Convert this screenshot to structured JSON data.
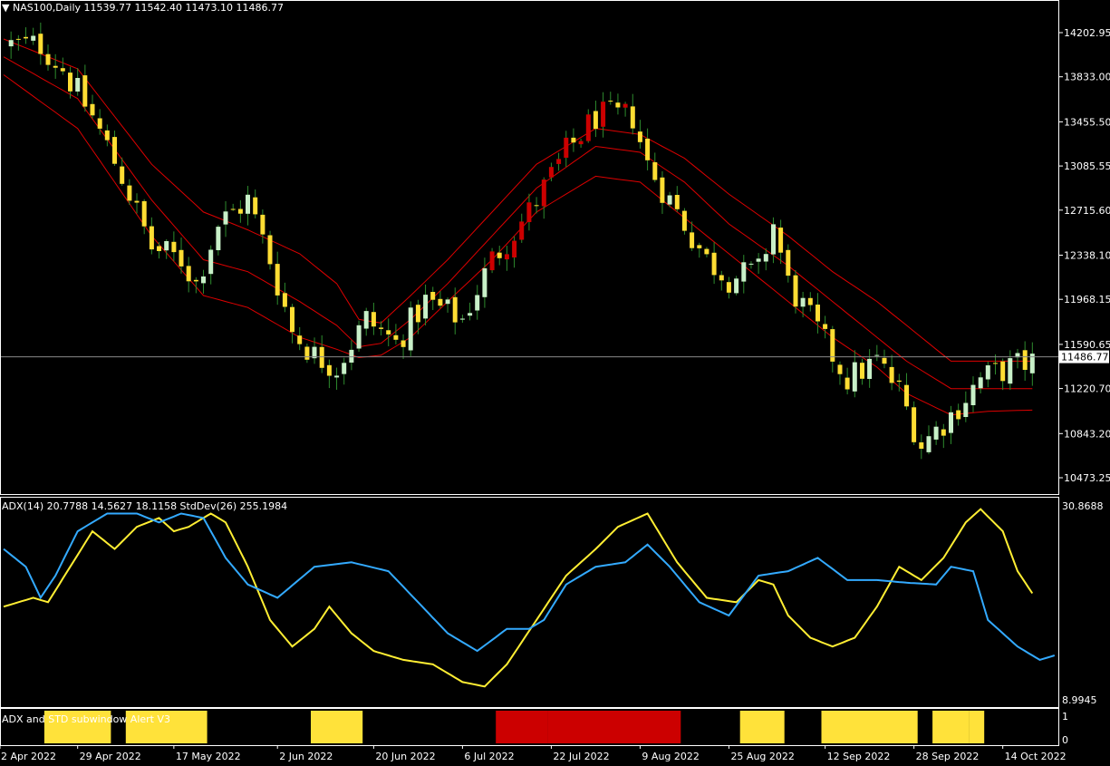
{
  "window": {
    "symbol_label": "NAS100,Daily",
    "ohlc": "11539.77 11542.40 11473.10 11486.77",
    "adx_label": "ADX(14) 20.7788 14.5627 18.1158  StdDev(26) 255.1984",
    "sub_label": "ADX and STD subwindow Alert V3"
  },
  "colors": {
    "background": "#000000",
    "grid_border": "#ffffff",
    "bull_candle": "#c8f0c8",
    "bear_candle": "#ffdd33",
    "red_candle": "#cc0000",
    "wick": "#2e8b2e",
    "envelope": "#dd0000",
    "adx_line": "#ffee33",
    "std_line": "#33aaff",
    "hist_yellow": "#ffe23a",
    "hist_red": "#cc0000",
    "price_line": "#8a8a8a"
  },
  "chart_data": [
    {
      "type": "candlestick",
      "panel": "price",
      "y_ticks": [
        "14202.95",
        "13833.00",
        "13455.50",
        "13085.55",
        "12715.60",
        "12338.10",
        "11968.15",
        "11590.65",
        "11220.70",
        "10843.20",
        "10473.25"
      ],
      "ylim": [
        10380,
        14360
      ],
      "current_price": "11486.77",
      "x_labels": [
        "12 Apr 2022",
        "29 Apr 2022",
        "17 May 2022",
        "2 Jun 2022",
        "20 Jun 2022",
        "6 Jul 2022",
        "22 Jul 2022",
        "9 Aug 2022",
        "25 Aug 2022",
        "12 Sep 2022",
        "28 Sep 2022",
        "14 Oct 2022"
      ],
      "close_path": [
        [
          0,
          14100
        ],
        [
          5,
          14100
        ],
        [
          8,
          13900
        ],
        [
          12,
          13500
        ],
        [
          16,
          13000
        ],
        [
          20,
          12400
        ],
        [
          24,
          12300
        ],
        [
          26,
          12100
        ],
        [
          29,
          12600
        ],
        [
          33,
          12800
        ],
        [
          36,
          12300
        ],
        [
          39,
          11700
        ],
        [
          42,
          11500
        ],
        [
          45,
          11400
        ],
        [
          49,
          11800
        ],
        [
          53,
          11600
        ],
        [
          57,
          11950
        ],
        [
          62,
          11800
        ],
        [
          66,
          12300
        ],
        [
          71,
          12700
        ],
        [
          76,
          13200
        ],
        [
          80,
          13500
        ],
        [
          85,
          13500
        ],
        [
          87,
          13100
        ],
        [
          91,
          12700
        ],
        [
          95,
          12300
        ],
        [
          98,
          12150
        ],
        [
          102,
          12200
        ],
        [
          104,
          12600
        ],
        [
          106,
          12100
        ],
        [
          110,
          11700
        ],
        [
          114,
          11300
        ],
        [
          118,
          11450
        ],
        [
          121,
          11200
        ],
        [
          124,
          10750
        ],
        [
          128,
          11000
        ],
        [
          132,
          11300
        ],
        [
          136,
          11400
        ],
        [
          139,
          11450
        ]
      ],
      "bands": {
        "upper": [
          [
            0,
            14150
          ],
          [
            10,
            13900
          ],
          [
            20,
            13100
          ],
          [
            27,
            12700
          ],
          [
            33,
            12550
          ],
          [
            40,
            12350
          ],
          [
            45,
            12100
          ],
          [
            48,
            11800
          ],
          [
            51,
            11770
          ],
          [
            55,
            12000
          ],
          [
            60,
            12300
          ],
          [
            66,
            12700
          ],
          [
            72,
            13100
          ],
          [
            80,
            13400
          ],
          [
            86,
            13350
          ],
          [
            92,
            13150
          ],
          [
            98,
            12850
          ],
          [
            106,
            12500
          ],
          [
            112,
            12200
          ],
          [
            118,
            11950
          ],
          [
            122,
            11750
          ],
          [
            128,
            11450
          ],
          [
            133,
            11450
          ],
          [
            139,
            11450
          ]
        ],
        "middle": [
          [
            0,
            14000
          ],
          [
            10,
            13650
          ],
          [
            20,
            12800
          ],
          [
            27,
            12300
          ],
          [
            33,
            12200
          ],
          [
            40,
            11950
          ],
          [
            45,
            11750
          ],
          [
            48,
            11570
          ],
          [
            51,
            11600
          ],
          [
            55,
            11800
          ],
          [
            60,
            12100
          ],
          [
            66,
            12500
          ],
          [
            72,
            12900
          ],
          [
            80,
            13250
          ],
          [
            86,
            13200
          ],
          [
            92,
            12950
          ],
          [
            98,
            12600
          ],
          [
            106,
            12250
          ],
          [
            112,
            11950
          ],
          [
            118,
            11650
          ],
          [
            122,
            11450
          ],
          [
            128,
            11220
          ],
          [
            133,
            11220
          ],
          [
            139,
            11220
          ]
        ],
        "lower": [
          [
            0,
            13850
          ],
          [
            10,
            13400
          ],
          [
            20,
            12500
          ],
          [
            27,
            12000
          ],
          [
            33,
            11900
          ],
          [
            40,
            11650
          ],
          [
            45,
            11550
          ],
          [
            48,
            11480
          ],
          [
            51,
            11500
          ],
          [
            55,
            11650
          ],
          [
            60,
            11950
          ],
          [
            66,
            12300
          ],
          [
            72,
            12700
          ],
          [
            80,
            13000
          ],
          [
            86,
            12950
          ],
          [
            92,
            12650
          ],
          [
            98,
            12350
          ],
          [
            106,
            11950
          ],
          [
            112,
            11650
          ],
          [
            118,
            11400
          ],
          [
            122,
            11180
          ],
          [
            128,
            11000
          ],
          [
            133,
            11030
          ],
          [
            139,
            11040
          ]
        ]
      }
    },
    {
      "type": "line",
      "panel": "indicator",
      "y_ticks": [
        "30.8688",
        "8.9945"
      ],
      "ylim": [
        8.9945,
        30.8688
      ],
      "series": [
        {
          "key": "adx",
          "color": "#ffee33",
          "points": [
            [
              0,
              19.5
            ],
            [
              4,
              20.5
            ],
            [
              6,
              20
            ],
            [
              9,
              24
            ],
            [
              12,
              28
            ],
            [
              15,
              26
            ],
            [
              18,
              28.5
            ],
            [
              21,
              29.5
            ],
            [
              23,
              28
            ],
            [
              25,
              28.5
            ],
            [
              28,
              30
            ],
            [
              30,
              29
            ],
            [
              33,
              24
            ],
            [
              36,
              18
            ],
            [
              39,
              15
            ],
            [
              42,
              17
            ],
            [
              44,
              19.5
            ],
            [
              47,
              16.5
            ],
            [
              50,
              14.5
            ],
            [
              54,
              13.5
            ],
            [
              58,
              13
            ],
            [
              62,
              11
            ],
            [
              65,
              10.5
            ],
            [
              68,
              13
            ],
            [
              72,
              18
            ],
            [
              76,
              23
            ],
            [
              80,
              26
            ],
            [
              83,
              28.5
            ],
            [
              87,
              30
            ],
            [
              91,
              24.5
            ],
            [
              95,
              20.5
            ],
            [
              99,
              20
            ],
            [
              102,
              22.5
            ],
            [
              104,
              22
            ],
            [
              106,
              18.5
            ],
            [
              109,
              16
            ],
            [
              112,
              15
            ],
            [
              115,
              16
            ],
            [
              118,
              19.5
            ],
            [
              121,
              24
            ],
            [
              124,
              22.5
            ],
            [
              127,
              25
            ],
            [
              130,
              29
            ],
            [
              132,
              30.5
            ],
            [
              135,
              28
            ],
            [
              137,
              23.5
            ],
            [
              139,
              21
            ]
          ]
        },
        {
          "key": "std",
          "color": "#33aaff",
          "points": [
            [
              0,
              26
            ],
            [
              3,
              24
            ],
            [
              5,
              20.5
            ],
            [
              7,
              23
            ],
            [
              10,
              28
            ],
            [
              14,
              30
            ],
            [
              18,
              30
            ],
            [
              21,
              29
            ],
            [
              24,
              30
            ],
            [
              27,
              29.5
            ],
            [
              30,
              25
            ],
            [
              33,
              22
            ],
            [
              37,
              20.5
            ],
            [
              42,
              24
            ],
            [
              47,
              24.5
            ],
            [
              52,
              23.5
            ],
            [
              56,
              20
            ],
            [
              60,
              16.5
            ],
            [
              64,
              14.5
            ],
            [
              68,
              17
            ],
            [
              71,
              17
            ],
            [
              73,
              18
            ],
            [
              76,
              22
            ],
            [
              80,
              24
            ],
            [
              84,
              24.5
            ],
            [
              87,
              26.5
            ],
            [
              90,
              24
            ],
            [
              94,
              20
            ],
            [
              98,
              18.5
            ],
            [
              102,
              23
            ],
            [
              106,
              23.5
            ],
            [
              110,
              25
            ],
            [
              114,
              22.5
            ],
            [
              118,
              22.5
            ],
            [
              122,
              22.2
            ],
            [
              126,
              22
            ],
            [
              128,
              24
            ],
            [
              131,
              23.5
            ],
            [
              133,
              18
            ],
            [
              137,
              15
            ],
            [
              140,
              13.5
            ],
            [
              142,
              14
            ]
          ]
        }
      ]
    },
    {
      "type": "bar",
      "panel": "signal",
      "y_ticks": [
        "1",
        "0"
      ],
      "ylim": [
        0,
        1
      ],
      "segments": [
        {
          "start": 6,
          "end": 14,
          "color": "yellow"
        },
        {
          "start": 17,
          "end": 23,
          "color": "yellow"
        },
        {
          "start": 24,
          "end": 27,
          "color": "yellow"
        },
        {
          "start": 42,
          "end": 48,
          "color": "yellow"
        },
        {
          "start": 67,
          "end": 73,
          "color": "red"
        },
        {
          "start": 74,
          "end": 83,
          "color": "red"
        },
        {
          "start": 84,
          "end": 91,
          "color": "red"
        },
        {
          "start": 100,
          "end": 105,
          "color": "yellow"
        },
        {
          "start": 111,
          "end": 123,
          "color": "yellow"
        },
        {
          "start": 126,
          "end": 130,
          "color": "yellow"
        },
        {
          "start": 131,
          "end": 132,
          "color": "yellow"
        }
      ]
    }
  ]
}
